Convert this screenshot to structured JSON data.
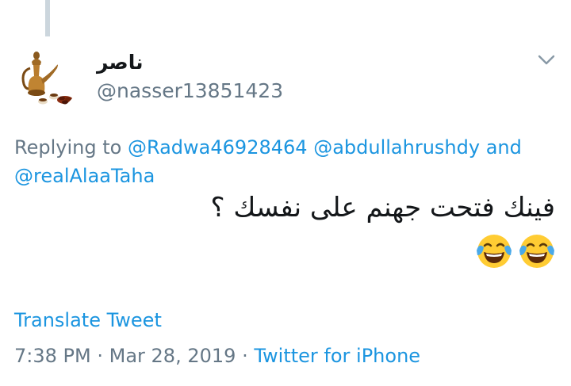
{
  "author": {
    "display_name": "ناصر",
    "handle": "@nasser13851423"
  },
  "reply": {
    "prefix": "Replying to",
    "mentions": [
      "@Radwa46928464",
      "@abdullahrushdy",
      "@realAlaaTaha"
    ],
    "conjunction": "and"
  },
  "tweet": {
    "text": "فينك فتحت جهنم على نفسك ؟",
    "emojis": [
      "face-with-tears-of-joy-icon",
      "face-with-tears-of-joy-icon"
    ]
  },
  "translate_label": "Translate Tweet",
  "meta": {
    "time": "7:38 PM",
    "separator": "·",
    "date": "Mar 28, 2019",
    "source": "Twitter for iPhone"
  },
  "colors": {
    "link": "#1b95e0",
    "secondary_text": "#657786",
    "primary_text": "#14171a",
    "thread_line": "#ccd6dd"
  }
}
